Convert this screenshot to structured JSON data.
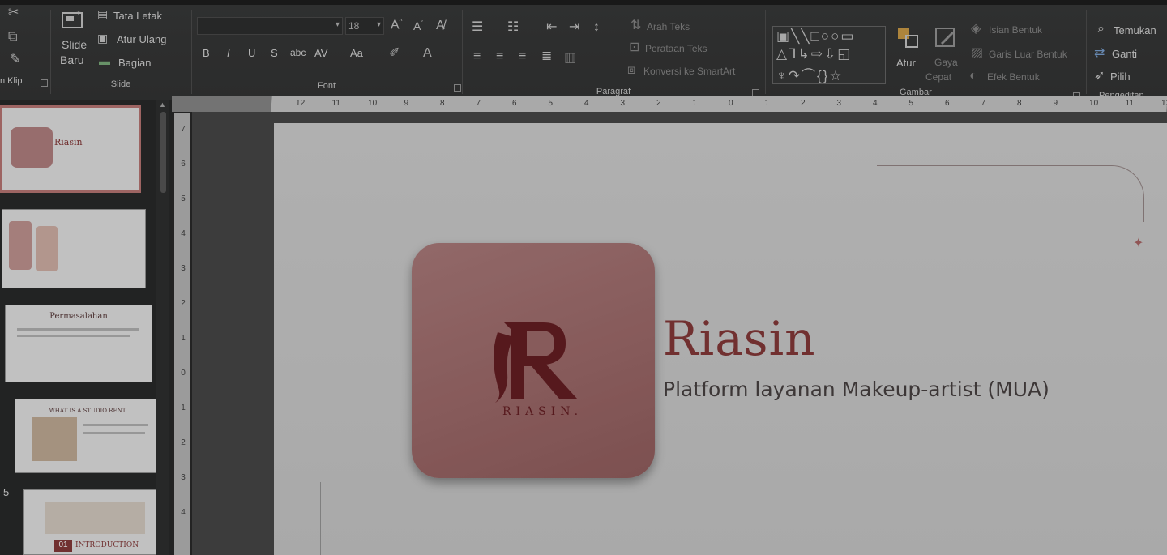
{
  "ribbon": {
    "clipboard": {
      "label": "n Klip"
    },
    "slide": {
      "new_slide_line1": "Slide",
      "new_slide_line2": "Baru",
      "layout": "Tata Letak",
      "reset": "Atur Ulang",
      "section": "Bagian",
      "label": "Slide"
    },
    "font": {
      "font_name": "",
      "font_size": "18",
      "bold": "B",
      "italic": "I",
      "underline": "U",
      "shadow": "S",
      "strike": "abc",
      "spacing": "AV",
      "case": "Aa",
      "label": "Font"
    },
    "paragraph": {
      "text_direction": "Arah Teks",
      "align_text": "Perataan Teks",
      "smartart": "Konversi ke SmartArt",
      "label": "Paragraf"
    },
    "drawing": {
      "arrange": "Atur",
      "quick_styles_line1": "Gaya",
      "quick_styles_line2": "Cepat",
      "shape_fill": "Isian Bentuk",
      "shape_outline": "Garis Luar Bentuk",
      "shape_effects": "Efek Bentuk",
      "label": "Gambar"
    },
    "editing": {
      "find": "Temukan",
      "replace": "Ganti",
      "select": "Pilih",
      "label": "Pengeditan"
    }
  },
  "thumbnails": {
    "items": [
      {
        "title": "Riasin",
        "active": true
      },
      {
        "title": "",
        "active": false
      },
      {
        "title": "Permasalahan",
        "active": false
      },
      {
        "title": "WHAT IS A STUDIO RENT",
        "active": false
      },
      {
        "title": "INTRODUCTION",
        "number_badge": "01",
        "active": false
      }
    ],
    "visible_number": "5"
  },
  "ruler": {
    "horizontal_ticks": [
      "12",
      "11",
      "10",
      "9",
      "8",
      "7",
      "6",
      "5",
      "4",
      "3",
      "2",
      "1",
      "0",
      "1",
      "2",
      "3",
      "4",
      "5",
      "6",
      "7",
      "8",
      "9",
      "10",
      "11",
      "12"
    ],
    "vertical_ticks": [
      "7",
      "6",
      "5",
      "4",
      "3",
      "2",
      "1",
      "0",
      "1",
      "2",
      "3",
      "4"
    ]
  },
  "slide": {
    "title": "Riasin",
    "subtitle": "Platform layanan Makeup-artist (MUA)",
    "logo_word": "RIASIN."
  },
  "colors": {
    "accent": "#8a3b3b",
    "logo_tile": "#a56f6f",
    "logo_mark": "#6a1f24"
  }
}
